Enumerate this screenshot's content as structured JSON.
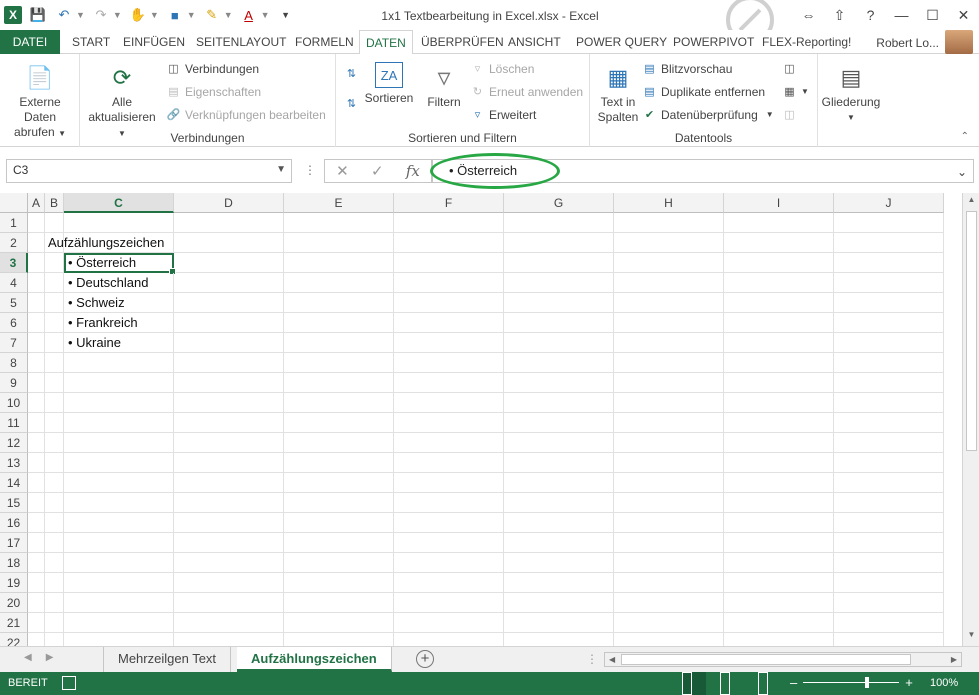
{
  "title": "1x1 Textbearbeitung in Excel.xlsx - Excel",
  "qat": {
    "logo": "X"
  },
  "tabs": {
    "file": "DATEI",
    "items": [
      "START",
      "EINFÜGEN",
      "SEITENLAYOUT",
      "FORMELN",
      "DATEN",
      "ÜBERPRÜFEN",
      "ANSICHT",
      "POWER QUERY",
      "POWERPIVOT",
      "FLEX-Reporting!"
    ],
    "active": "DATEN"
  },
  "user": "Robert Lo...",
  "ribbon": {
    "external": {
      "line1": "Externe Daten",
      "line2": "abrufen"
    },
    "refresh": {
      "line1": "Alle",
      "line2": "aktualisieren"
    },
    "connections": {
      "item1": "Verbindungen",
      "item2": "Eigenschaften",
      "item3": "Verknüpfungen bearbeiten",
      "label": "Verbindungen"
    },
    "sort": {
      "sort_label": "Sortieren",
      "filter_label": "Filtern",
      "clear": "Löschen",
      "reapply": "Erneut anwenden",
      "advanced": "Erweitert",
      "label": "Sortieren und Filtern"
    },
    "tools": {
      "text_line1": "Text in",
      "text_line2": "Spalten",
      "flash": "Blitzvorschau",
      "remove_dup": "Duplikate entfernen",
      "validation": "Datenüberprüfung",
      "label": "Datentools"
    },
    "outline": {
      "label": "Gliederung"
    }
  },
  "formula_bar": {
    "namebox": "C3",
    "content": "• Österreich"
  },
  "columns": [
    "A",
    "B",
    "C",
    "D",
    "E",
    "F",
    "G",
    "H",
    "I",
    "J"
  ],
  "selected_column": "C",
  "rows": [
    "1",
    "2",
    "3",
    "4",
    "5",
    "6",
    "7",
    "8",
    "9",
    "10",
    "11",
    "12",
    "13",
    "14",
    "15",
    "16",
    "17",
    "18",
    "19",
    "20",
    "21",
    "22"
  ],
  "selected_row": "3",
  "cells": {
    "b2": "Aufzählungszeichen",
    "c3": "• Österreich",
    "c4": "• Deutschland",
    "c5": "• Schweiz",
    "c6": "• Frankreich",
    "c7": "• Ukraine"
  },
  "sheets": [
    "Mehrzeilgen Text",
    "Aufzählungszeichen"
  ],
  "active_sheet": "Aufzählungszeichen",
  "status": {
    "ready": "BEREIT",
    "zoom": "100%"
  },
  "colors": {
    "accent": "#217346",
    "highlight_oval": "#28a745"
  }
}
